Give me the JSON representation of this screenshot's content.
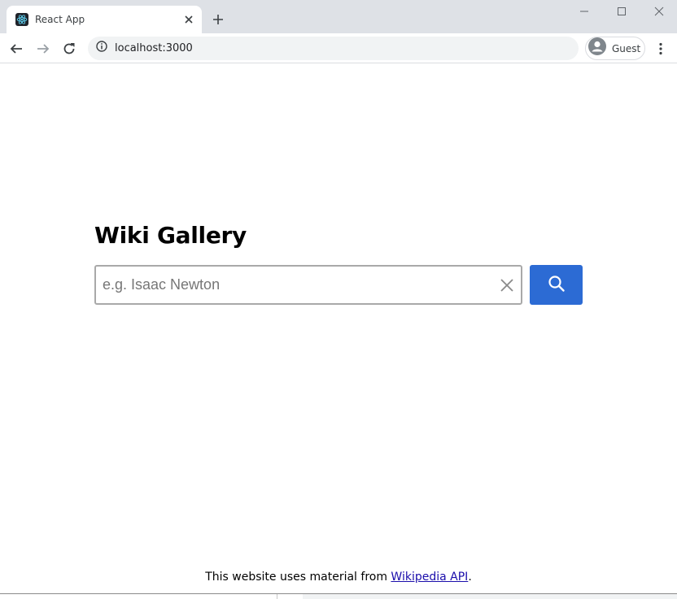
{
  "tab": {
    "title": "React App",
    "favicon": "react-logo-icon",
    "favicon_bg": "#20232a",
    "favicon_color": "#61dafb"
  },
  "toolbar": {
    "url": "localhost:3000",
    "profile_name": "Guest"
  },
  "page": {
    "title": "Wiki Gallery",
    "search_placeholder": "e.g. Isaac Newton",
    "search_value": "",
    "search_button_icon": "search-icon",
    "clear_icon": "close-icon",
    "accent_color": "#2c6bd4"
  },
  "footer": {
    "prefix": "This website uses material from ",
    "link_text": "Wikipedia API",
    "suffix": "."
  }
}
